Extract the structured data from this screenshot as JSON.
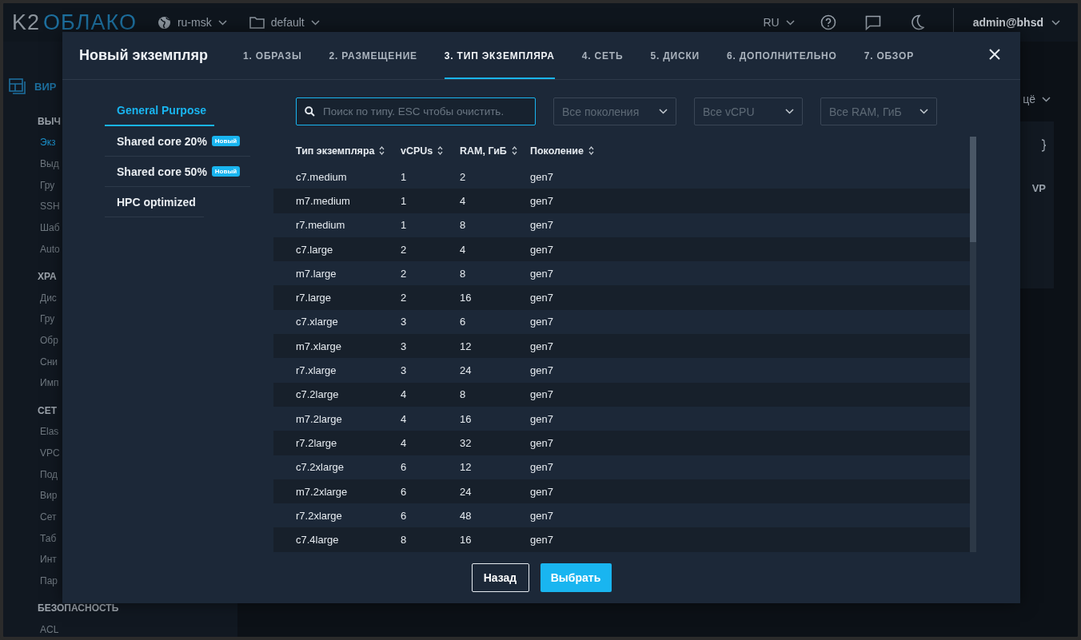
{
  "topbar": {
    "logo": {
      "k2": "K2",
      "name": "ОБЛАКО"
    },
    "region": "ru-msk",
    "project": "default",
    "language": "RU",
    "user": "admin@bhsd"
  },
  "sidebar": {
    "section": "ВИР",
    "groups": [
      {
        "title": "ВЫЧ",
        "items": [
          {
            "label": "Экз",
            "selected": true
          },
          {
            "label": "Выд",
            "selected": false
          },
          {
            "label": "Гру",
            "selected": false
          },
          {
            "label": "SSH",
            "selected": false
          },
          {
            "label": "Шаб",
            "selected": false
          },
          {
            "label": "Auto",
            "selected": false
          }
        ]
      },
      {
        "title": "ХРА",
        "items": [
          {
            "label": "Дис",
            "selected": false
          },
          {
            "label": "Гру",
            "selected": false
          },
          {
            "label": "Обр",
            "selected": false
          },
          {
            "label": "Сни",
            "selected": false
          },
          {
            "label": "Имп",
            "selected": false
          }
        ]
      },
      {
        "title": "СЕТ",
        "items": [
          {
            "label": "Elas",
            "selected": false
          },
          {
            "label": "VPC",
            "selected": false
          },
          {
            "label": "Под",
            "selected": false
          },
          {
            "label": "Вир",
            "selected": false
          },
          {
            "label": "Сет",
            "selected": false
          },
          {
            "label": "Таб",
            "selected": false
          },
          {
            "label": "Инт",
            "selected": false
          },
          {
            "label": "Пар",
            "selected": false
          }
        ]
      },
      {
        "title": "БЕЗОПАСНОСТЬ",
        "items": [
          {
            "label": "ACL",
            "selected": false
          }
        ]
      }
    ]
  },
  "background": {
    "menu_label": "цё",
    "column_label": "VP"
  },
  "modal": {
    "title": "Новый экземпляр",
    "steps": [
      {
        "label": "1. ОБРАЗЫ",
        "selected": false
      },
      {
        "label": "2. РАЗМЕЩЕНИЕ",
        "selected": false
      },
      {
        "label": "3. ТИП ЭКЗЕМПЛЯРА",
        "selected": true
      },
      {
        "label": "4. СЕТЬ",
        "selected": false
      },
      {
        "label": "5. ДИСКИ",
        "selected": false
      },
      {
        "label": "6. ДОПОЛНИТЕЛЬНО",
        "selected": false
      },
      {
        "label": "7. ОБЗОР",
        "selected": false
      }
    ],
    "categories": [
      {
        "label": "General Purpose",
        "selected": true
      },
      {
        "label": "Shared core 20%",
        "badge": "Новый",
        "selected": false
      },
      {
        "label": "Shared core 50%",
        "badge": "Новый",
        "selected": false
      },
      {
        "label": "HPC optimized",
        "selected": false
      }
    ],
    "search": {
      "placeholder": "Поиск по типу. ESC чтобы очистить."
    },
    "filters": [
      {
        "placeholder": "Все поколения"
      },
      {
        "placeholder": "Все vCPU"
      },
      {
        "placeholder": "Все RAM, ГиБ"
      }
    ],
    "table": {
      "columns": [
        "Тип экземпляра",
        "vCPUs",
        "RAM, ГиБ",
        "Поколение"
      ],
      "rows": [
        [
          "c7.medium",
          "1",
          "2",
          "gen7"
        ],
        [
          "m7.medium",
          "1",
          "4",
          "gen7"
        ],
        [
          "r7.medium",
          "1",
          "8",
          "gen7"
        ],
        [
          "c7.large",
          "2",
          "4",
          "gen7"
        ],
        [
          "m7.large",
          "2",
          "8",
          "gen7"
        ],
        [
          "r7.large",
          "2",
          "16",
          "gen7"
        ],
        [
          "c7.xlarge",
          "3",
          "6",
          "gen7"
        ],
        [
          "m7.xlarge",
          "3",
          "12",
          "gen7"
        ],
        [
          "r7.xlarge",
          "3",
          "24",
          "gen7"
        ],
        [
          "c7.2large",
          "4",
          "8",
          "gen7"
        ],
        [
          "m7.2large",
          "4",
          "16",
          "gen7"
        ],
        [
          "r7.2large",
          "4",
          "32",
          "gen7"
        ],
        [
          "c7.2xlarge",
          "6",
          "12",
          "gen7"
        ],
        [
          "m7.2xlarge",
          "6",
          "24",
          "gen7"
        ],
        [
          "r7.2xlarge",
          "6",
          "48",
          "gen7"
        ],
        [
          "c7.4large",
          "8",
          "16",
          "gen7"
        ]
      ]
    },
    "buttons": {
      "back": "Назад",
      "select": "Выбрать"
    }
  }
}
